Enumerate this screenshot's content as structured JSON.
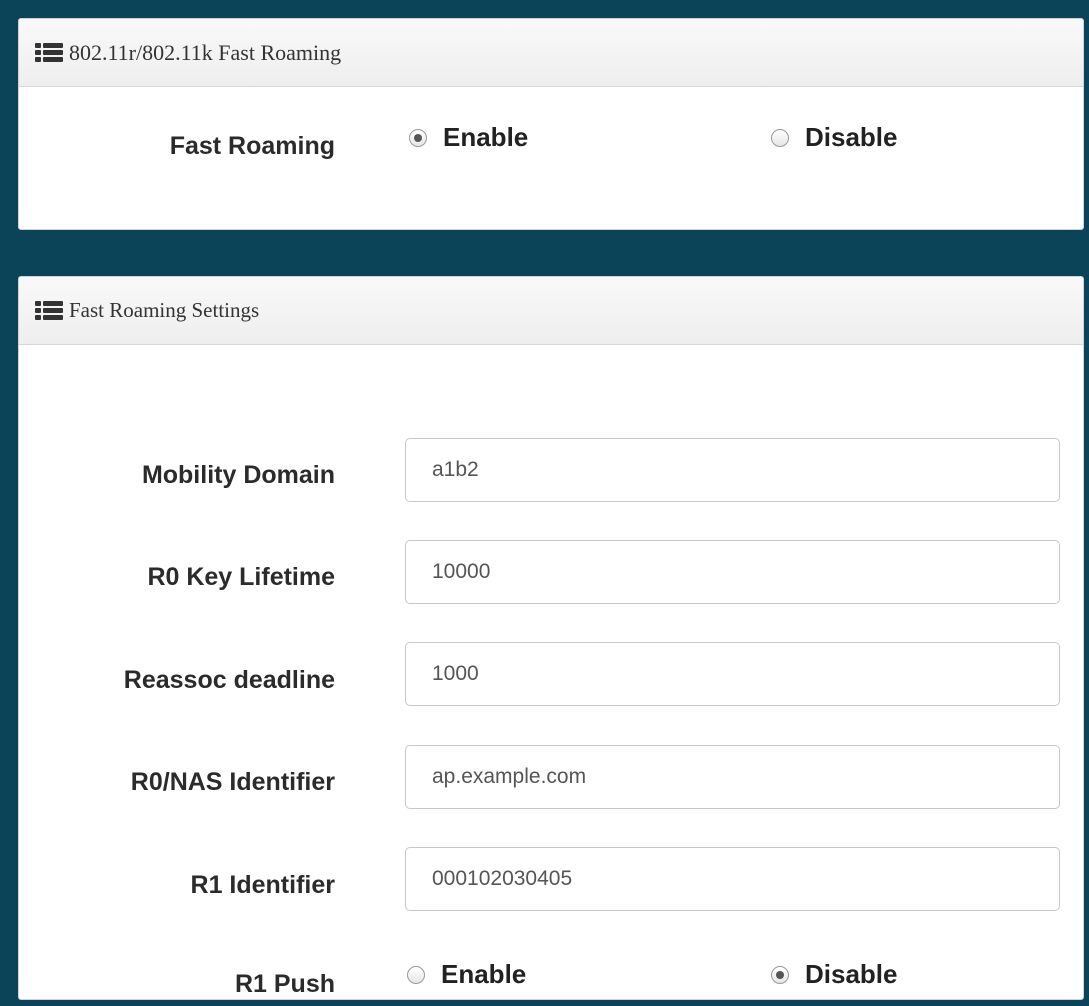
{
  "roaming_panel": {
    "title": "802.11r/802.11k Fast Roaming",
    "icon": "list-icon",
    "fast_roaming": {
      "label": "Fast Roaming",
      "options": [
        {
          "label": "Enable",
          "checked": true
        },
        {
          "label": "Disable",
          "checked": false
        }
      ]
    }
  },
  "settings_panel": {
    "title": "Fast Roaming Settings",
    "icon": "list-icon",
    "fields": {
      "mobility_domain": {
        "label": "Mobility Domain",
        "value": "a1b2"
      },
      "r0_key_lifetime": {
        "label": "R0 Key Lifetime",
        "value": "10000"
      },
      "reassoc_deadline": {
        "label": "Reassoc deadline",
        "value": "1000"
      },
      "r0_nas_identifier": {
        "label": "R0/NAS Identifier",
        "value": "ap.example.com"
      },
      "r1_identifier": {
        "label": "R1 Identifier",
        "value": "000102030405"
      }
    },
    "r1_push": {
      "label": "R1 Push",
      "options": [
        {
          "label": "Enable",
          "checked": false
        },
        {
          "label": "Disable",
          "checked": true
        }
      ]
    }
  },
  "colors": {
    "background": "#0b4458",
    "panel": "#ffffff",
    "header": "#f1f1f1",
    "label_text": "#2b2b2b"
  }
}
